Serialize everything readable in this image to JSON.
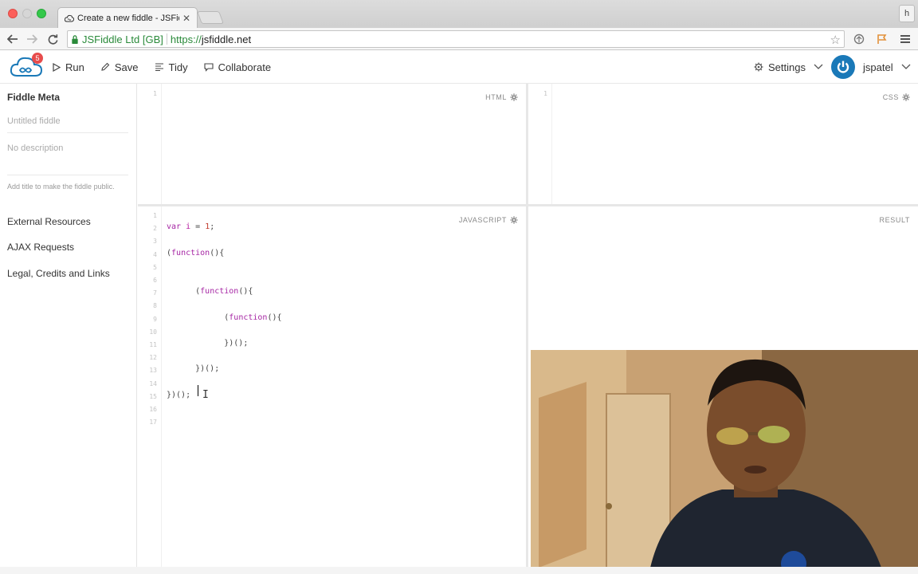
{
  "browser": {
    "tab_title": "Create a new fiddle - JSFiddle",
    "profile_initial": "h",
    "ev_name": "JSFiddle Ltd [GB]",
    "url_scheme": "https://",
    "url_host": "jsfiddle.net"
  },
  "header": {
    "notification_count": "5",
    "run_label": "Run",
    "save_label": "Save",
    "tidy_label": "Tidy",
    "collaborate_label": "Collaborate",
    "settings_label": "Settings",
    "username": "jspatel",
    "brand_color": "#1a79b8"
  },
  "sidebar": {
    "title": "Fiddle Meta",
    "title_placeholder": "Untitled fiddle",
    "description_placeholder": "No description",
    "hint": "Add title to make the fiddle public.",
    "links": [
      "External Resources",
      "AJAX Requests",
      "Legal, Credits and Links"
    ]
  },
  "panels": {
    "html_label": "HTML",
    "css_label": "CSS",
    "js_label": "JAVASCRIPT",
    "result_label": "RESULT",
    "html_line": "1",
    "css_line": "1"
  },
  "js_code": {
    "line_numbers": [
      "1",
      "2",
      "3",
      "4",
      "5",
      "6",
      "7",
      "8",
      "9",
      "10",
      "11",
      "12",
      "13",
      "14",
      "15",
      "16",
      "17"
    ],
    "lines": [
      "",
      "var i = 1;",
      "",
      "(function(){",
      "",
      "",
      "      (function(){",
      "",
      "            (function(){",
      "",
      "            })();",
      "",
      "      })();",
      "",
      "})();",
      "",
      ""
    ]
  }
}
